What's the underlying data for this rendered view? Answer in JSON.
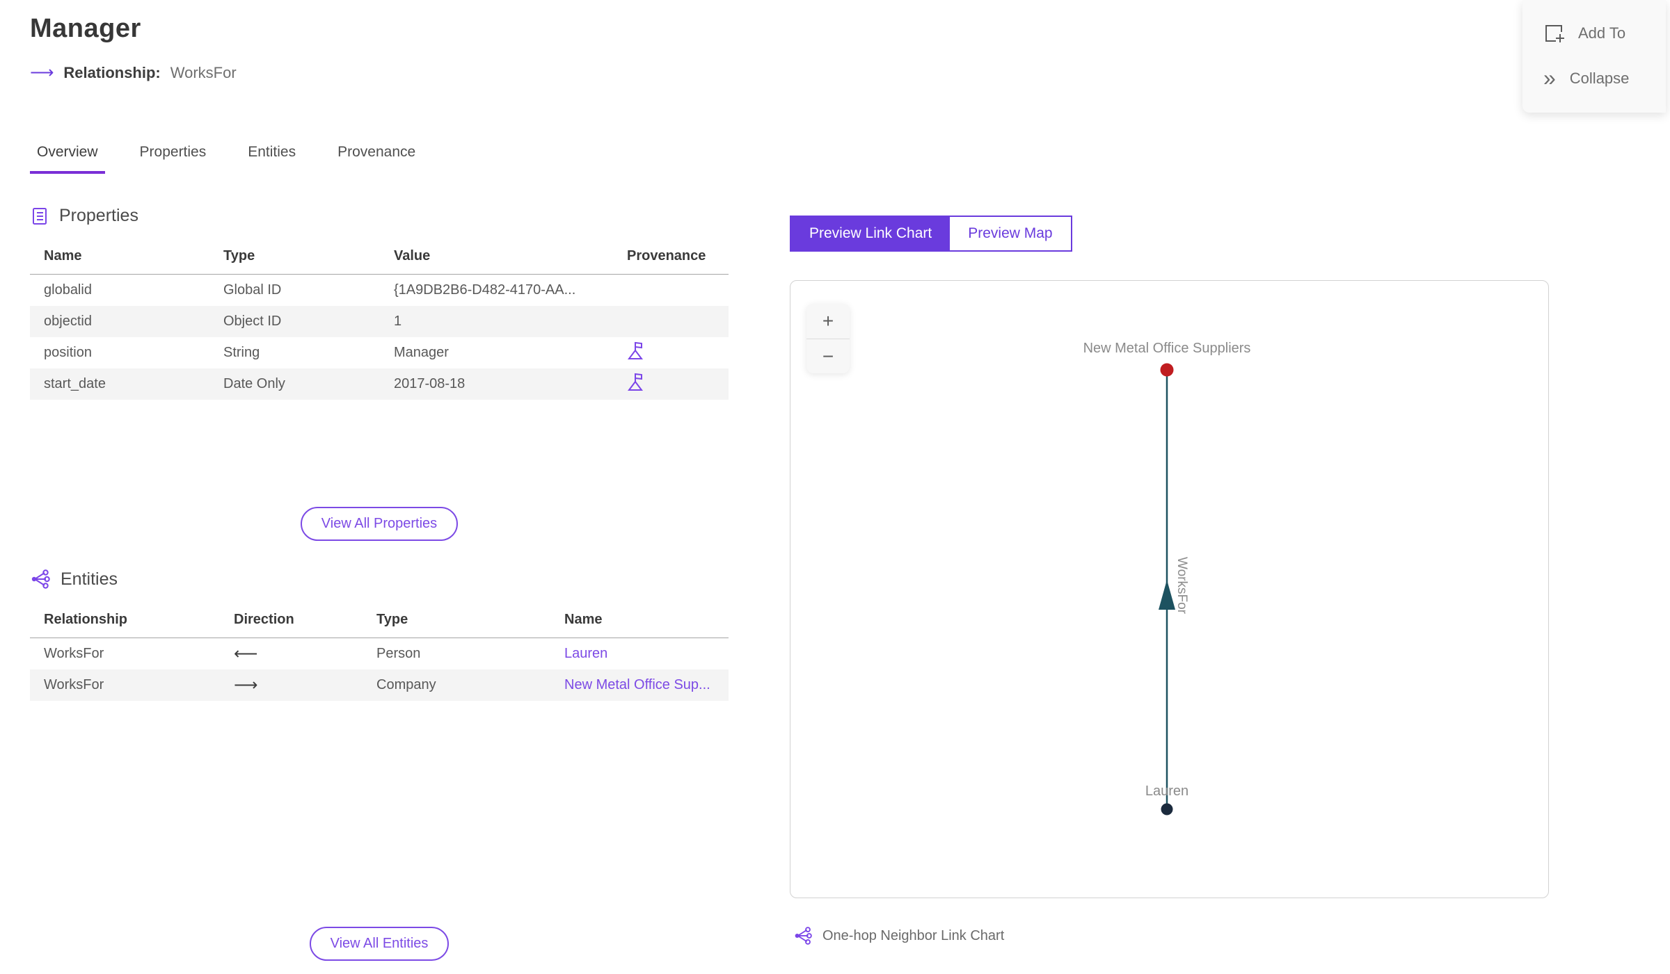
{
  "header": {
    "title": "Manager",
    "relationship": {
      "arrow": "⟶",
      "label": "Relationship:",
      "value": "WorksFor"
    }
  },
  "top_actions": {
    "add_to": "Add To",
    "collapse": "Collapse",
    "collapse_glyph": "»"
  },
  "tabs": {
    "items": [
      {
        "label": "Overview",
        "active": true
      },
      {
        "label": "Properties",
        "active": false
      },
      {
        "label": "Entities",
        "active": false
      },
      {
        "label": "Provenance",
        "active": false
      }
    ]
  },
  "properties": {
    "title": "Properties",
    "columns": [
      "Name",
      "Type",
      "Value",
      "Provenance"
    ],
    "rows": [
      {
        "name": "globalid",
        "type": "Global ID",
        "value": "{1A9DB2B6-D482-4170-AA...",
        "has_provenance": false
      },
      {
        "name": "objectid",
        "type": "Object ID",
        "value": "1",
        "has_provenance": false
      },
      {
        "name": "position",
        "type": "String",
        "value": "Manager",
        "has_provenance": true
      },
      {
        "name": "start_date",
        "type": "Date Only",
        "value": "2017-08-18",
        "has_provenance": true
      }
    ],
    "view_all_label": "View All Properties"
  },
  "entities": {
    "title": "Entities",
    "columns": [
      "Relationship",
      "Direction",
      "Type",
      "Name"
    ],
    "rows": [
      {
        "relationship": "WorksFor",
        "direction": "⟵",
        "type": "Person",
        "name": "Lauren"
      },
      {
        "relationship": "WorksFor",
        "direction": "⟶",
        "type": "Company",
        "name": "New Metal Office Sup..."
      }
    ],
    "view_all_label": "View All Entities"
  },
  "preview": {
    "toggle": [
      {
        "label": "Preview Link Chart",
        "active": true
      },
      {
        "label": "Preview Map",
        "active": false
      }
    ],
    "zoom_in": "+",
    "zoom_out": "−",
    "caption": "One-hop Neighbor Link Chart"
  },
  "chart_data": {
    "type": "link-chart",
    "nodes": [
      {
        "id": "company",
        "label": "New Metal Office Suppliers",
        "color": "#c01d20"
      },
      {
        "id": "person",
        "label": "Lauren",
        "color": "#1b2a3d"
      }
    ],
    "edges": [
      {
        "from": "person",
        "to": "company",
        "label": "WorksFor",
        "color": "#1d5260",
        "arrow_direction": "up"
      }
    ]
  },
  "colors": {
    "accent": "#6a3bdd",
    "link": "#7c4ae5",
    "tab_underline": "#7a2fd6",
    "edge_teal": "#1d5260",
    "node_company_red": "#c01d20",
    "node_person_navy": "#1b2a3d"
  }
}
